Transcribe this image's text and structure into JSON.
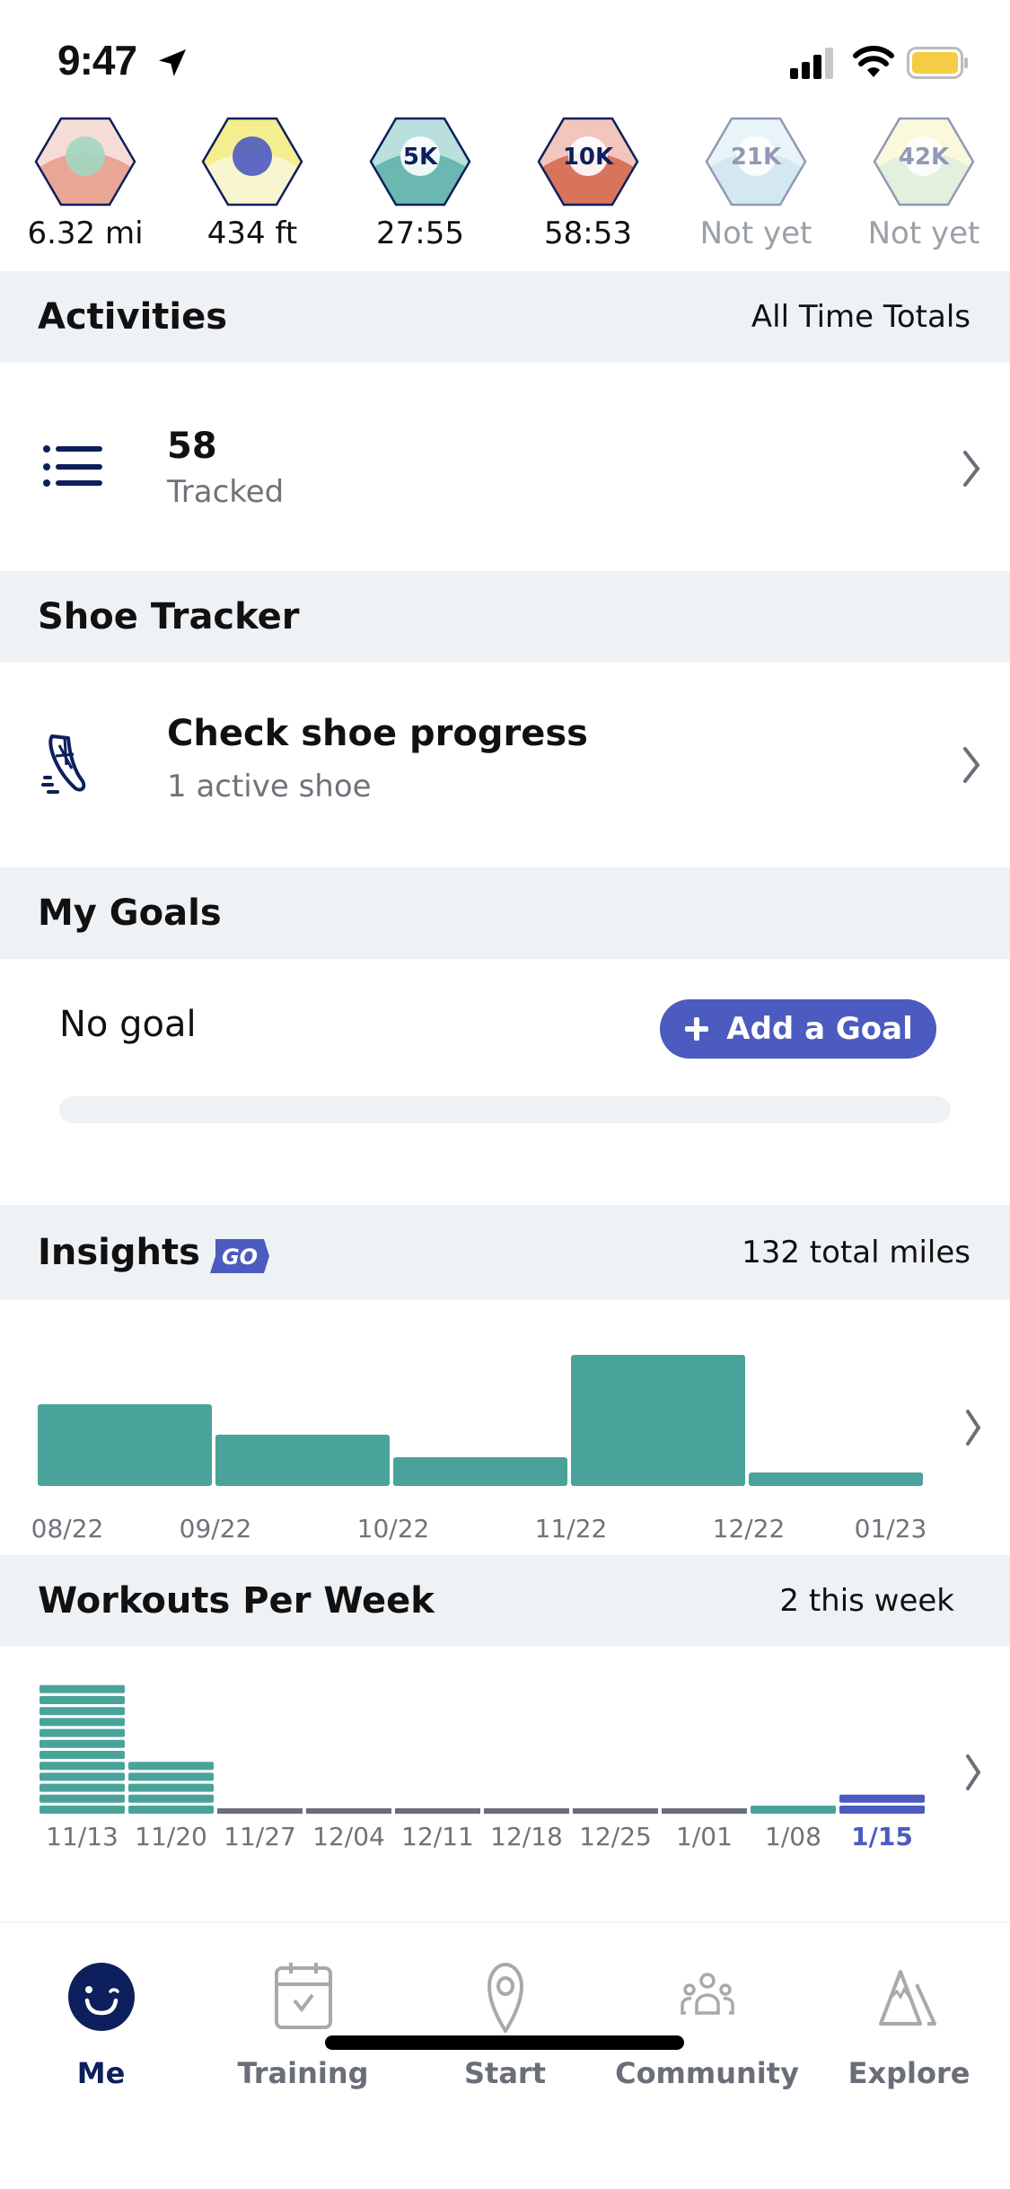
{
  "status_bar": {
    "time": "9:47",
    "location_icon": "location-arrow-icon",
    "signal_icon": "signal-icon",
    "wifi_icon": "wifi-icon",
    "battery_icon": "battery-icon",
    "battery_color": "#f5cc45"
  },
  "badges": [
    {
      "name": "longest-run",
      "value": "6.32 mi",
      "achieved": true,
      "colors": [
        "#f6dcd6",
        "#e9a695",
        "#a2d7c1"
      ]
    },
    {
      "name": "elevation",
      "value": "434 ft",
      "achieved": true,
      "colors": [
        "#f4ee8f",
        "#f8f6d0",
        "#4c5bbf"
      ]
    },
    {
      "name": "5k",
      "label": "5K",
      "value": "27:55",
      "achieved": true,
      "colors": [
        "#b9e0de",
        "#6bb8b0",
        "#ffffff"
      ]
    },
    {
      "name": "10k",
      "label": "10K",
      "value": "58:53",
      "achieved": true,
      "colors": [
        "#f2c6bd",
        "#d9745c",
        "#ffffff"
      ]
    },
    {
      "name": "half-marathon",
      "label": "21K",
      "value": "Not yet",
      "achieved": false,
      "colors": [
        "#cfe8f2",
        "#9fcde0",
        "#ffffff"
      ]
    },
    {
      "name": "marathon",
      "label": "42K",
      "value": "Not yet",
      "achieved": false,
      "colors": [
        "#f4f2b0",
        "#bfe0b5",
        "#ffffff"
      ]
    }
  ],
  "activities": {
    "title": "Activities",
    "right": "All Time Totals",
    "count": "58",
    "count_label": "Tracked"
  },
  "shoe_tracker": {
    "title": "Shoe Tracker",
    "main": "Check shoe progress",
    "sub": "1 active shoe"
  },
  "goals": {
    "title": "My Goals",
    "status": "No goal",
    "add_button": "Add a Goal",
    "progress": 0
  },
  "insights": {
    "title": "Insights",
    "badge": "GO",
    "right": "132 total miles"
  },
  "workouts": {
    "title": "Workouts Per Week",
    "right": "2 this week"
  },
  "chart_data": [
    {
      "type": "bar",
      "title": "Insights",
      "subtitle": "132 total miles",
      "tick_labels": [
        "08/22",
        "09/22",
        "10/22",
        "11/22",
        "12/22",
        "01/23"
      ],
      "categories": [
        "08/22",
        "09/22",
        "10/22",
        "11/22",
        "12/22"
      ],
      "values": [
        35.2,
        22.1,
        12.4,
        56.5,
        5.8
      ],
      "ylabel": "miles",
      "ylim": [
        0,
        60
      ],
      "grid": false,
      "bar_color": "#4aa39a"
    },
    {
      "type": "bar",
      "title": "Workouts Per Week",
      "subtitle": "2 this week",
      "categories": [
        "11/13",
        "11/20",
        "11/27",
        "12/04",
        "12/11",
        "12/18",
        "12/25",
        "1/01",
        "1/08",
        "1/15"
      ],
      "values": [
        12,
        5,
        0,
        0,
        0,
        0,
        0,
        0,
        1,
        2
      ],
      "highlight_index": 9,
      "ylabel": "workouts",
      "ylim": [
        0,
        12
      ],
      "grid": false,
      "colors": {
        "bar": "#4aa39a",
        "empty": "#6a6e78",
        "current": "#4c5bbf",
        "current_label": "#4c5bbf"
      }
    }
  ],
  "tabbar": {
    "tabs": [
      {
        "label": "Me",
        "icon": "me-smiley-icon",
        "active": true
      },
      {
        "label": "Training",
        "icon": "calendar-check-icon",
        "active": false
      },
      {
        "label": "Start",
        "icon": "map-pin-icon",
        "active": false
      },
      {
        "label": "Community",
        "icon": "community-people-icon",
        "active": false
      },
      {
        "label": "Explore",
        "icon": "mountain-icon",
        "active": false
      }
    ]
  }
}
